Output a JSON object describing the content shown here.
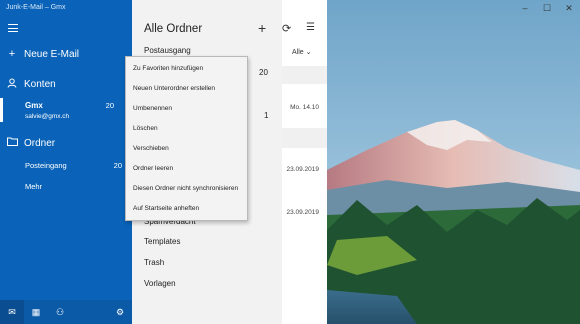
{
  "window": {
    "title": "Junk-E-Mail – Gmx",
    "minimize_glyph": "–",
    "maximize_glyph": "☐",
    "close_glyph": "✕"
  },
  "sidebar": {
    "new_mail_label": "Neue E-Mail",
    "accounts_label": "Konten",
    "account": {
      "name": "Gmx",
      "email": "salvie@gmx.ch",
      "count": "20"
    },
    "folders_label": "Ordner",
    "folders": [
      {
        "label": "Posteingang",
        "count": "20"
      },
      {
        "label": "Mehr",
        "count": ""
      }
    ],
    "icons": {
      "hamburger": "menu-icon",
      "new_mail": "plus-icon",
      "accounts": "person-icon",
      "folders": "folder-icon"
    },
    "bottom_icons": [
      "mail-icon",
      "calendar-icon",
      "people-icon",
      "settings-icon"
    ],
    "bottom_glyphs": [
      "✉",
      "▦",
      "⚇",
      "⚙"
    ]
  },
  "folder_panel": {
    "title": "Alle Ordner",
    "add_glyph": "+",
    "sync_glyph": "⟳",
    "select_glyph": "☰",
    "filter_label": "Alle",
    "filter_caret": "⌄",
    "items": [
      {
        "label": "Postausgang",
        "count": "20"
      },
      {
        "label": "Spamverdacht",
        "count": ""
      },
      {
        "label": "Templates",
        "count": ""
      },
      {
        "label": "Trash",
        "count": ""
      },
      {
        "label": "Vorlagen",
        "count": ""
      }
    ],
    "posteingang_count_row2": "1"
  },
  "mail_list": {
    "dates": [
      "Mo. 14.10",
      "23.09.2019",
      "23.09.2019"
    ]
  },
  "context_menu": {
    "items": [
      "Zu Favoriten hinzufügen",
      "Neuen Unterordner erstellen",
      "Umbenennen",
      "Löschen",
      "Verschieben",
      "Ordner leeren",
      "Diesen Ordner nicht synchronisieren",
      "Auf Startseite anheften"
    ]
  },
  "colors": {
    "sidebar_bg": "#0a63b8",
    "panel_bg": "#f2f2f2",
    "menu_bg": "#f3f3f3"
  }
}
